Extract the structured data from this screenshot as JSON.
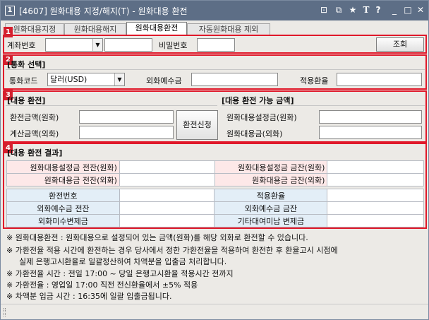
{
  "window": {
    "app_num": "1",
    "title": "[4607] 원화대용 지정/해지(T) - 원화대용 환전",
    "ctrl_pin": "⊡",
    "ctrl_copy": "⧉",
    "ctrl_star": "★",
    "ctrl_font": "T",
    "ctrl_help": "?",
    "ctrl_min": "_",
    "ctrl_max": "□",
    "ctrl_close": "✕"
  },
  "tabs": [
    {
      "label": "원화대용지정"
    },
    {
      "label": "원화대용해지"
    },
    {
      "label": "원화대용환전"
    },
    {
      "label": "자동원화대용 제외"
    }
  ],
  "badges": [
    "1",
    "2",
    "3",
    "4"
  ],
  "account": {
    "account_label": "계좌번호",
    "password_label": "비밀번호",
    "query_button": "조회"
  },
  "currency": {
    "header": "[통화 선택]",
    "code_label": "통화코드",
    "code_value": "달러(USD)",
    "deposit_label": "외화예수금",
    "rate_label": "적용환율"
  },
  "exchange": {
    "header": "[대용 환전]",
    "amount_krw_label": "환전금액(원화)",
    "calc_fx_label": "계산금액(외화)",
    "apply_button": "환전신청"
  },
  "available": {
    "header": "[대용 환전 가능 금액]",
    "set_krw_label": "원화대용설정금(원화)",
    "amount_fx_label": "원화대용금(외화)"
  },
  "result": {
    "header": "[대용 환전 결과]",
    "rows1": [
      [
        "원화대용설정금 전잔(원화)",
        "원화대용설정금 금잔(원화)"
      ],
      [
        "원화대용금 전잔(외화)",
        "원화대용금 금잔(외화)"
      ]
    ],
    "rows2": [
      [
        "환전번호",
        "적용환율"
      ],
      [
        "외화예수금 전잔",
        "외화예수금 금잔"
      ],
      [
        "외화미수변제금",
        "기타대여미납 변제금"
      ]
    ]
  },
  "notes": [
    "※ 원화대용환전 : 원화대용으로 설정되어 있는 금액(원화)를 해당 외화로 환전할 수 있습니다.",
    "※ 가환전율 적용 시간에 환전하는 경우 당사에서 정한 가환전율을 적용하여 환전한 후 환율고시 시점에",
    "실제 은행고시환율로 일괄정산하여 차액분을 입출금 처리합니다.",
    "※ 가환전율 시간 : 전일 17:00 ~ 당일 은행고시환율 적용시간 전까지",
    "※ 가환전율 : 영업일 17:00 직전 전신환율에서 ±5% 적용",
    "※ 차액분 입금 시간 : 16:35에 일괄 입출금됩니다."
  ]
}
